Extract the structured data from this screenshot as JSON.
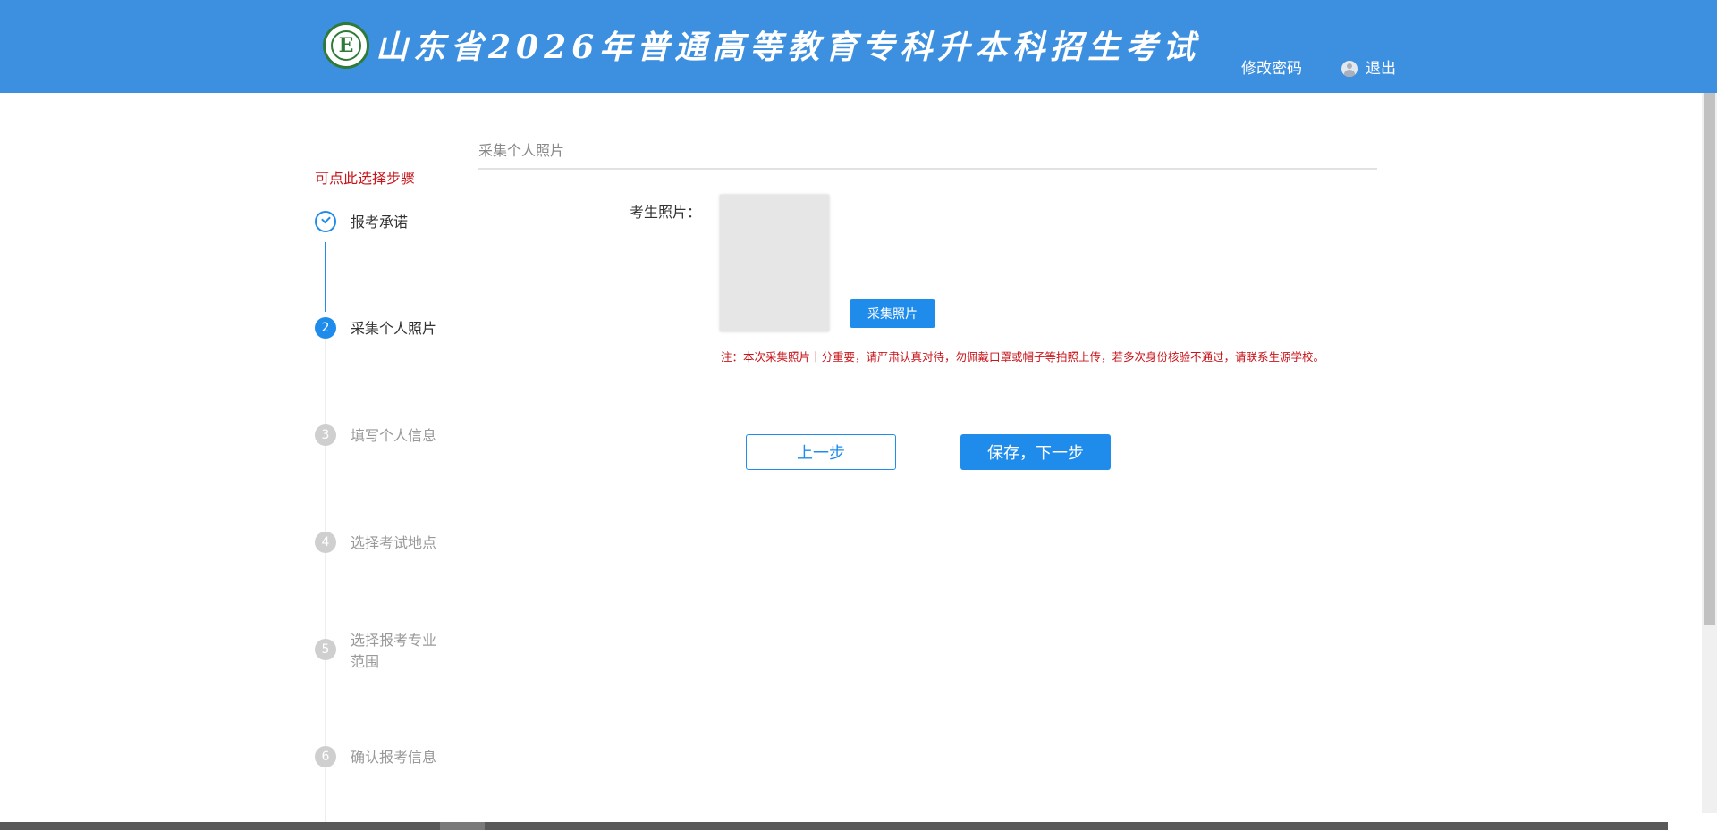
{
  "header": {
    "title": "山东省2026年普通高等教育专科升本科招生考试",
    "logo_letter": "E",
    "change_password": "修改密码",
    "logout": "退出"
  },
  "steps": {
    "hint": "可点此选择步骤",
    "items": [
      {
        "number": "✓",
        "label": "报考承诺",
        "state": "done"
      },
      {
        "number": "2",
        "label": "采集个人照片",
        "state": "active"
      },
      {
        "number": "3",
        "label": "填写个人信息",
        "state": "pending"
      },
      {
        "number": "4",
        "label": "选择考试地点",
        "state": "pending"
      },
      {
        "number": "5",
        "label": "选择报考专业范围",
        "state": "pending"
      },
      {
        "number": "6",
        "label": "确认报考信息",
        "state": "pending"
      }
    ]
  },
  "main": {
    "section_title": "采集个人照片",
    "photo_label": "考生照片：",
    "capture_button": "采集照片",
    "note": "注：本次采集照片十分重要，请严肃认真对待，勿佩戴口罩或帽子等拍照上传，若多次身份核验不通过，请联系生源学校。",
    "prev_button": "上一步",
    "next_button": "保存，下一步"
  },
  "colors": {
    "header_bg": "#3d8fe0",
    "primary": "#1f8ceb",
    "warning_text": "#c9141a"
  }
}
